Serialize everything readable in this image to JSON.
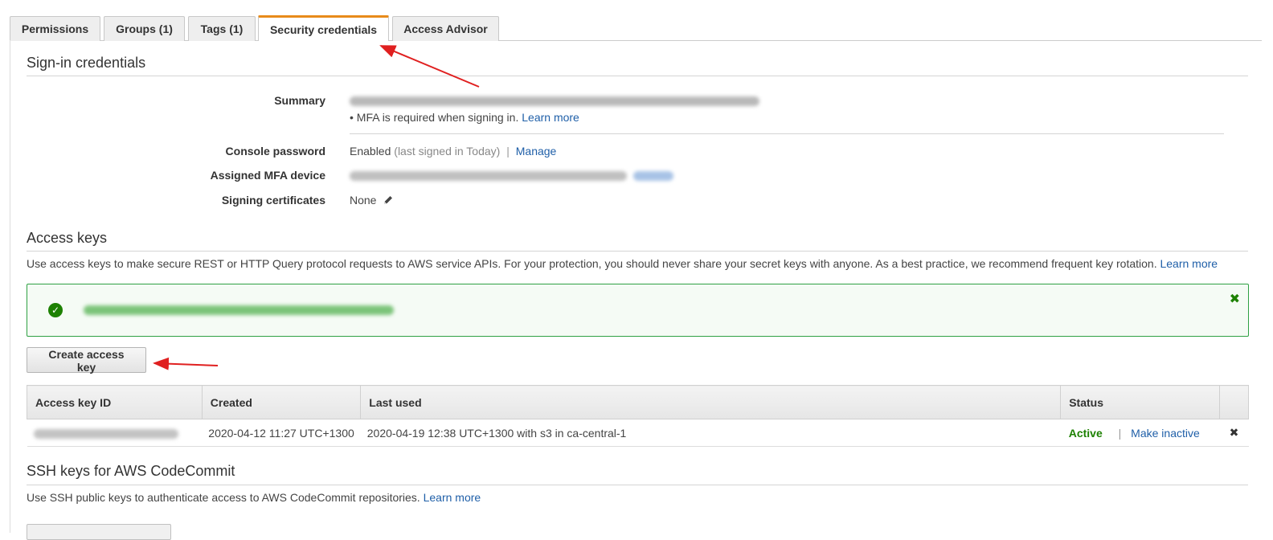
{
  "tabs": [
    {
      "label": "Permissions"
    },
    {
      "label": "Groups (1)"
    },
    {
      "label": "Tags (1)"
    },
    {
      "label": "Security credentials"
    },
    {
      "label": "Access Advisor"
    }
  ],
  "signin": {
    "title": "Sign-in credentials",
    "summary_label": "Summary",
    "mfa_note": "MFA is required when signing in.",
    "mfa_learn_more": "Learn more",
    "console_password_label": "Console password",
    "console_password_value": "Enabled",
    "console_password_meta": "(last signed in Today)",
    "separator": "|",
    "manage_link": "Manage",
    "mfa_device_label": "Assigned MFA device",
    "signing_certificates_label": "Signing certificates",
    "signing_certificates_value": "None"
  },
  "access_keys": {
    "title": "Access keys",
    "description": "Use access keys to make secure REST or HTTP Query protocol requests to AWS service APIs. For your protection, you should never share your secret keys with anyone. As a best practice, we recommend frequent key rotation.",
    "learn_more": "Learn more",
    "alert_close": "✖",
    "create_button": "Create access key",
    "columns": [
      "Access key ID",
      "Created",
      "Last used",
      "Status",
      ""
    ],
    "rows": [
      {
        "created": "2020-04-12 11:27 UTC+1300",
        "last_used": "2020-04-19 12:38 UTC+1300 with s3 in ca-central-1",
        "status": "Active",
        "separator": "|",
        "action": "Make inactive",
        "delete": "✖"
      }
    ]
  },
  "ssh": {
    "title": "SSH keys for AWS CodeCommit",
    "description": "Use SSH public keys to authenticate access to AWS CodeCommit repositories.",
    "learn_more": "Learn more"
  },
  "colors": {
    "accent_tab": "#e88b1a",
    "link": "#1f5fa8",
    "success": "#1d8102",
    "annotation": "#e02020"
  },
  "icons": {
    "alert": "check-circle-icon",
    "edit": "pencil-icon",
    "close": "close-icon",
    "delete": "delete-icon"
  }
}
